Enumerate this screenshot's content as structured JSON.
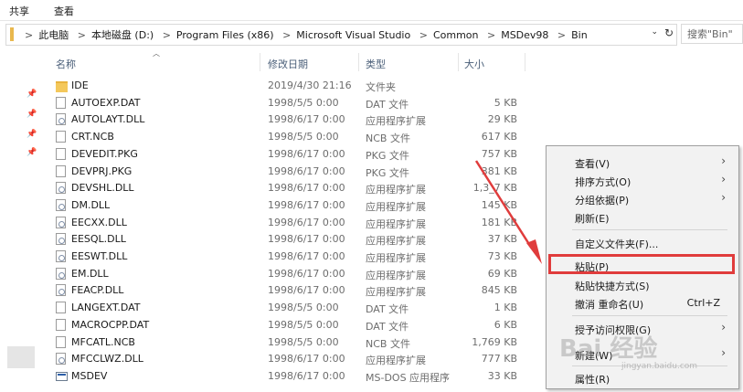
{
  "ribbon": {
    "tabs": [
      "共享",
      "查看"
    ]
  },
  "address": {
    "crumbs": [
      "此电脑",
      "本地磁盘 (D:)",
      "Program Files (x86)",
      "Microsoft Visual Studio",
      "Common",
      "MSDev98",
      "Bin"
    ],
    "separator": ">",
    "dropdown_glyph": "⌄",
    "refresh_glyph": "↻"
  },
  "search": {
    "placeholder": "搜索\"Bin\""
  },
  "columns": {
    "name": "名称",
    "date": "修改日期",
    "type": "类型",
    "size": "大小"
  },
  "files": [
    {
      "name": "IDE",
      "date": "2019/4/30 21:16",
      "type": "文件夹",
      "size": "",
      "icon": "folder-icon"
    },
    {
      "name": "AUTOEXP.DAT",
      "date": "1998/5/5 0:00",
      "type": "DAT 文件",
      "size": "5 KB",
      "icon": "file-icon"
    },
    {
      "name": "AUTOLAYT.DLL",
      "date": "1998/6/17 0:00",
      "type": "应用程序扩展",
      "size": "29 KB",
      "icon": "dll-icon"
    },
    {
      "name": "CRT.NCB",
      "date": "1998/5/5 0:00",
      "type": "NCB 文件",
      "size": "617 KB",
      "icon": "file-icon"
    },
    {
      "name": "DEVEDIT.PKG",
      "date": "1998/6/17 0:00",
      "type": "PKG 文件",
      "size": "757 KB",
      "icon": "file-icon"
    },
    {
      "name": "DEVPRJ.PKG",
      "date": "1998/6/17 0:00",
      "type": "PKG 文件",
      "size": "381 KB",
      "icon": "file-icon"
    },
    {
      "name": "DEVSHL.DLL",
      "date": "1998/6/17 0:00",
      "type": "应用程序扩展",
      "size": "1,3_7 KB",
      "icon": "dll-icon"
    },
    {
      "name": "DM.DLL",
      "date": "1998/6/17 0:00",
      "type": "应用程序扩展",
      "size": "145 KB",
      "icon": "dll-icon"
    },
    {
      "name": "EECXX.DLL",
      "date": "1998/6/17 0:00",
      "type": "应用程序扩展",
      "size": "181 KB",
      "icon": "dll-icon"
    },
    {
      "name": "EESQL.DLL",
      "date": "1998/6/17 0:00",
      "type": "应用程序扩展",
      "size": "37 KB",
      "icon": "dll-icon"
    },
    {
      "name": "EESWT.DLL",
      "date": "1998/6/17 0:00",
      "type": "应用程序扩展",
      "size": "73 KB",
      "icon": "dll-icon"
    },
    {
      "name": "EM.DLL",
      "date": "1998/6/17 0:00",
      "type": "应用程序扩展",
      "size": "69 KB",
      "icon": "dll-icon"
    },
    {
      "name": "FEACP.DLL",
      "date": "1998/6/17 0:00",
      "type": "应用程序扩展",
      "size": "845 KB",
      "icon": "dll-icon"
    },
    {
      "name": "LANGEXT.DAT",
      "date": "1998/5/5 0:00",
      "type": "DAT 文件",
      "size": "1 KB",
      "icon": "file-icon"
    },
    {
      "name": "MACROCPP.DAT",
      "date": "1998/5/5 0:00",
      "type": "DAT 文件",
      "size": "6 KB",
      "icon": "file-icon"
    },
    {
      "name": "MFCATL.NCB",
      "date": "1998/5/5 0:00",
      "type": "NCB 文件",
      "size": "1,769 KB",
      "icon": "file-icon"
    },
    {
      "name": "MFCCLWZ.DLL",
      "date": "1998/6/17 0:00",
      "type": "应用程序扩展",
      "size": "777 KB",
      "icon": "dll-icon"
    },
    {
      "name": "MSDEV",
      "date": "1998/6/17 0:00",
      "type": "MS-DOS 应用程序",
      "size": "33 KB",
      "icon": "exe-icon"
    }
  ],
  "context_menu": {
    "items": [
      {
        "label": "查看(V)",
        "submenu": true
      },
      {
        "label": "排序方式(O)",
        "submenu": true
      },
      {
        "label": "分组依据(P)",
        "submenu": true
      },
      {
        "label": "刷新(E)",
        "submenu": false
      },
      {
        "separator": true
      },
      {
        "label": "自定义文件夹(F)...",
        "submenu": false
      },
      {
        "separator": true
      },
      {
        "label": "粘贴(P)",
        "submenu": false,
        "highlighted": true
      },
      {
        "label": "粘贴快捷方式(S)",
        "submenu": false
      },
      {
        "label": "撤消 重命名(U)",
        "submenu": false,
        "shortcut": "Ctrl+Z"
      },
      {
        "separator": true
      },
      {
        "label": "授予访问权限(G)",
        "submenu": true
      },
      {
        "label": "新建(W)",
        "submenu": true
      },
      {
        "separator": true
      },
      {
        "label": "属性(R)",
        "submenu": false
      }
    ],
    "submenu_glyph": "›"
  },
  "highlight_color": "#e03c3c",
  "arrow_color": "#e03c3c",
  "watermark": {
    "text": "Bai 经验",
    "sub": "jingyan.baidu.com"
  }
}
